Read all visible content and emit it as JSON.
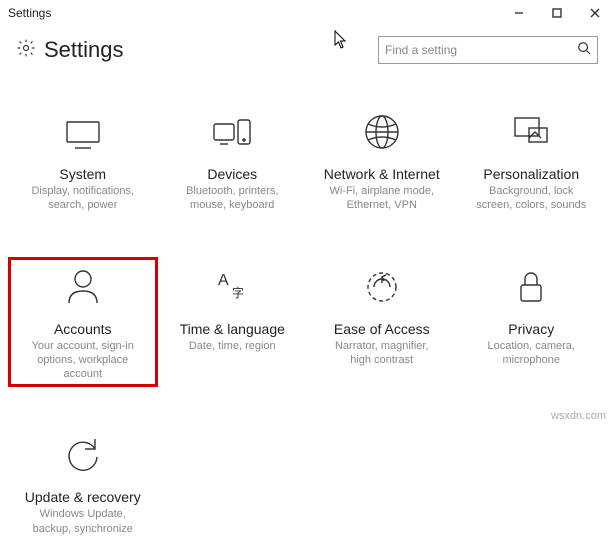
{
  "window": {
    "title": "Settings"
  },
  "header": {
    "title": "Settings"
  },
  "search": {
    "placeholder": "Find a setting"
  },
  "tiles": [
    {
      "icon": "system",
      "label": "System",
      "desc": "Display, notifications,\nsearch, power"
    },
    {
      "icon": "devices",
      "label": "Devices",
      "desc": "Bluetooth, printers,\nmouse, keyboard"
    },
    {
      "icon": "network",
      "label": "Network & Internet",
      "desc": "Wi-Fi, airplane mode,\nEthernet, VPN"
    },
    {
      "icon": "personalization",
      "label": "Personalization",
      "desc": "Background, lock\nscreen, colors, sounds"
    },
    {
      "icon": "accounts",
      "label": "Accounts",
      "desc": "Your account, sign-in\noptions, workplace\naccount",
      "highlight": true
    },
    {
      "icon": "time",
      "label": "Time & language",
      "desc": "Date, time, region"
    },
    {
      "icon": "ease",
      "label": "Ease of Access",
      "desc": "Narrator, magnifier,\nhigh contrast"
    },
    {
      "icon": "privacy",
      "label": "Privacy",
      "desc": "Location, camera,\nmicrophone"
    },
    {
      "icon": "update",
      "label": "Update & recovery",
      "desc": "Windows Update,\nbackup, synchronize"
    }
  ],
  "watermark": "wsxdn.com"
}
